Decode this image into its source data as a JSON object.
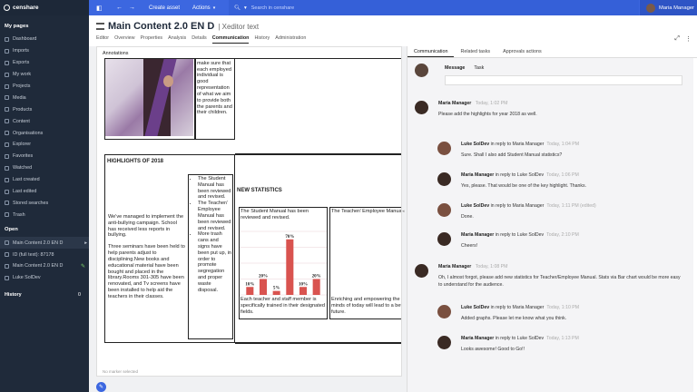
{
  "topbar": {
    "logo": "censhare",
    "create_asset": "Create asset",
    "actions": "Actions",
    "search_placeholder": "Search in censhare",
    "user_name": "Maria Manager"
  },
  "sidebar": {
    "my_pages_heading": "My pages",
    "my_pages": [
      "Dashboard",
      "Imports",
      "Exports",
      "My work",
      "Projects",
      "Media",
      "Products",
      "Content",
      "Organisations",
      "Explorer",
      "Favorites",
      "Watched",
      "Last created",
      "Last edited",
      "Stored searches",
      "Trash"
    ],
    "open_heading": "Open",
    "open_items": [
      "Main Content 2.0 EN D",
      "ID (full text): 87178",
      "Main Content 2.0 EN D",
      "Luke SolDev"
    ],
    "history_heading": "History",
    "history_count": "0"
  },
  "header": {
    "title": "Main Content 2.0 EN D",
    "subtitle": "| Xeditor text",
    "tabs": [
      "Editor",
      "Overview",
      "Properties",
      "Analysis",
      "Details",
      "Communication",
      "History",
      "Administration"
    ],
    "active_tab": "Communication"
  },
  "document": {
    "label": "Annotations",
    "col_text_top": "performance to make sure that each employed individual is good representation of what we aim to provide both the parents and their children.",
    "highlights_heading": "HIGHLIGHTS OF 2018",
    "highlights_body": "We've managed to implement the anti-bullying campaign. School has received less reports in bullying.",
    "seminars_body": "Three seminars have been held to help parents adjust to disciplining.New books and educational material have been bought and placed in the library.Rooms 301-305 have been renovated, and Tv screens have been installed to help aid the teachers in their classes.",
    "bullets": [
      "The Student Manual has been reviewed and revised.",
      "The Teacher/ Employee Manual has been reviewed and revised.",
      "More trash cans and signs have been put up, in order to promote segregation and proper waste disposal."
    ],
    "new_stats_heading": "NEW STATISTICS",
    "stat1_caption": "The Student Manual has been reviewed and revised.",
    "stat2_caption": "The Teacher/ Employee Manual has been reviewed and revised.",
    "stat1_footer": "Each teacher and staff member is specifically trained in their designated fields.",
    "stat2_footer": "Enriching and empowering the minds of today will lead to a better future.",
    "footer_status": "No marker selected"
  },
  "chart_data": {
    "type": "bar",
    "categories": [
      "1",
      "2",
      "3",
      "4",
      "5",
      "6"
    ],
    "values": [
      10,
      20,
      5,
      70,
      10,
      20
    ],
    "value_labels": [
      "10%",
      "20%",
      "5%",
      "70%",
      "10%",
      "20%"
    ],
    "ylim": [
      0,
      80
    ]
  },
  "right": {
    "tabs": [
      "Communication",
      "Related tasks",
      "Approvals actions"
    ],
    "active_tab": "Communication",
    "compose_tabs": [
      "Message",
      "Task"
    ],
    "messages": [
      {
        "author": "Maria Manager",
        "reply": "",
        "time": "Today, 1:02 PM",
        "body": "Please add the highlights for year 2018 as well."
      },
      {
        "author": "Luke SolDev",
        "reply": "in reply to Maria Manager",
        "time": "Today, 1:04 PM",
        "body": "Sure. Shall I also add Student Manual statistics?"
      },
      {
        "author": "Maria Manager",
        "reply": "in reply to Luke SolDev",
        "time": "Today, 1:06 PM",
        "body": "Yes, please. That would be one of the key highlight. Thanks."
      },
      {
        "author": "Luke SolDev",
        "reply": "in reply to Maria Manager",
        "time": "Today, 1:11 PM (edited)",
        "body": "Done."
      },
      {
        "author": "Maria Manager",
        "reply": "in reply to Luke SolDev",
        "time": "Today, 2:10 PM",
        "body": "Cheers!"
      },
      {
        "author": "Maria Manager",
        "reply": "",
        "time": "Today, 1:08 PM",
        "body": "Oh, I almost forgot, please add new statistics for Teacher/Employee Manual. Stats via Bar chart would be more easy to understand for the audience."
      },
      {
        "author": "Luke SolDev",
        "reply": "in reply to Maria Manager",
        "time": "Today, 1:10 PM",
        "body": "Added graphs. Please let me know what you think."
      },
      {
        "author": "Maria Manager",
        "reply": "in reply to Luke SolDev",
        "time": "Today, 1:13 PM",
        "body": "Looks awesome! Good to Go!!"
      }
    ]
  }
}
